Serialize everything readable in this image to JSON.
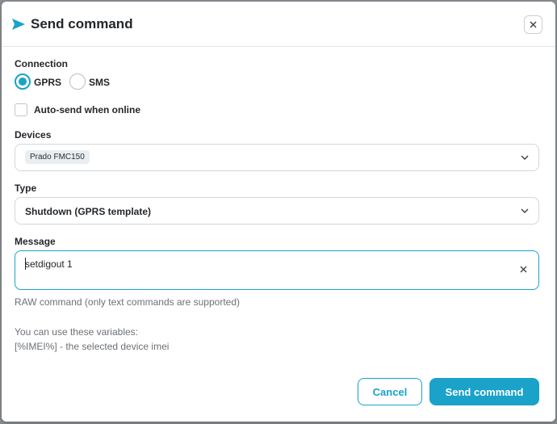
{
  "dialog": {
    "title": "Send command",
    "close_icon": "close-icon",
    "send_icon": "send-arrow-icon"
  },
  "connection": {
    "label": "Connection",
    "options": [
      {
        "label": "GPRS",
        "selected": true
      },
      {
        "label": "SMS",
        "selected": false
      }
    ]
  },
  "auto_send": {
    "label": "Auto-send when online",
    "checked": false
  },
  "devices": {
    "label": "Devices",
    "selected_chips": [
      "Prado FMC150"
    ]
  },
  "type": {
    "label": "Type",
    "selected": "Shutdown (GPRS template)"
  },
  "message": {
    "label": "Message",
    "value": "setdigout 1",
    "hint": "RAW command (only text commands are supported)",
    "variables_intro": "You can use these variables:",
    "variables": [
      "[%IMEI%] - the selected device imei"
    ]
  },
  "actions": {
    "cancel_label": "Cancel",
    "send_label": "Send command"
  },
  "colors": {
    "accent": "#1aa2c9",
    "text": "#23272b",
    "muted": "#6b7177"
  }
}
